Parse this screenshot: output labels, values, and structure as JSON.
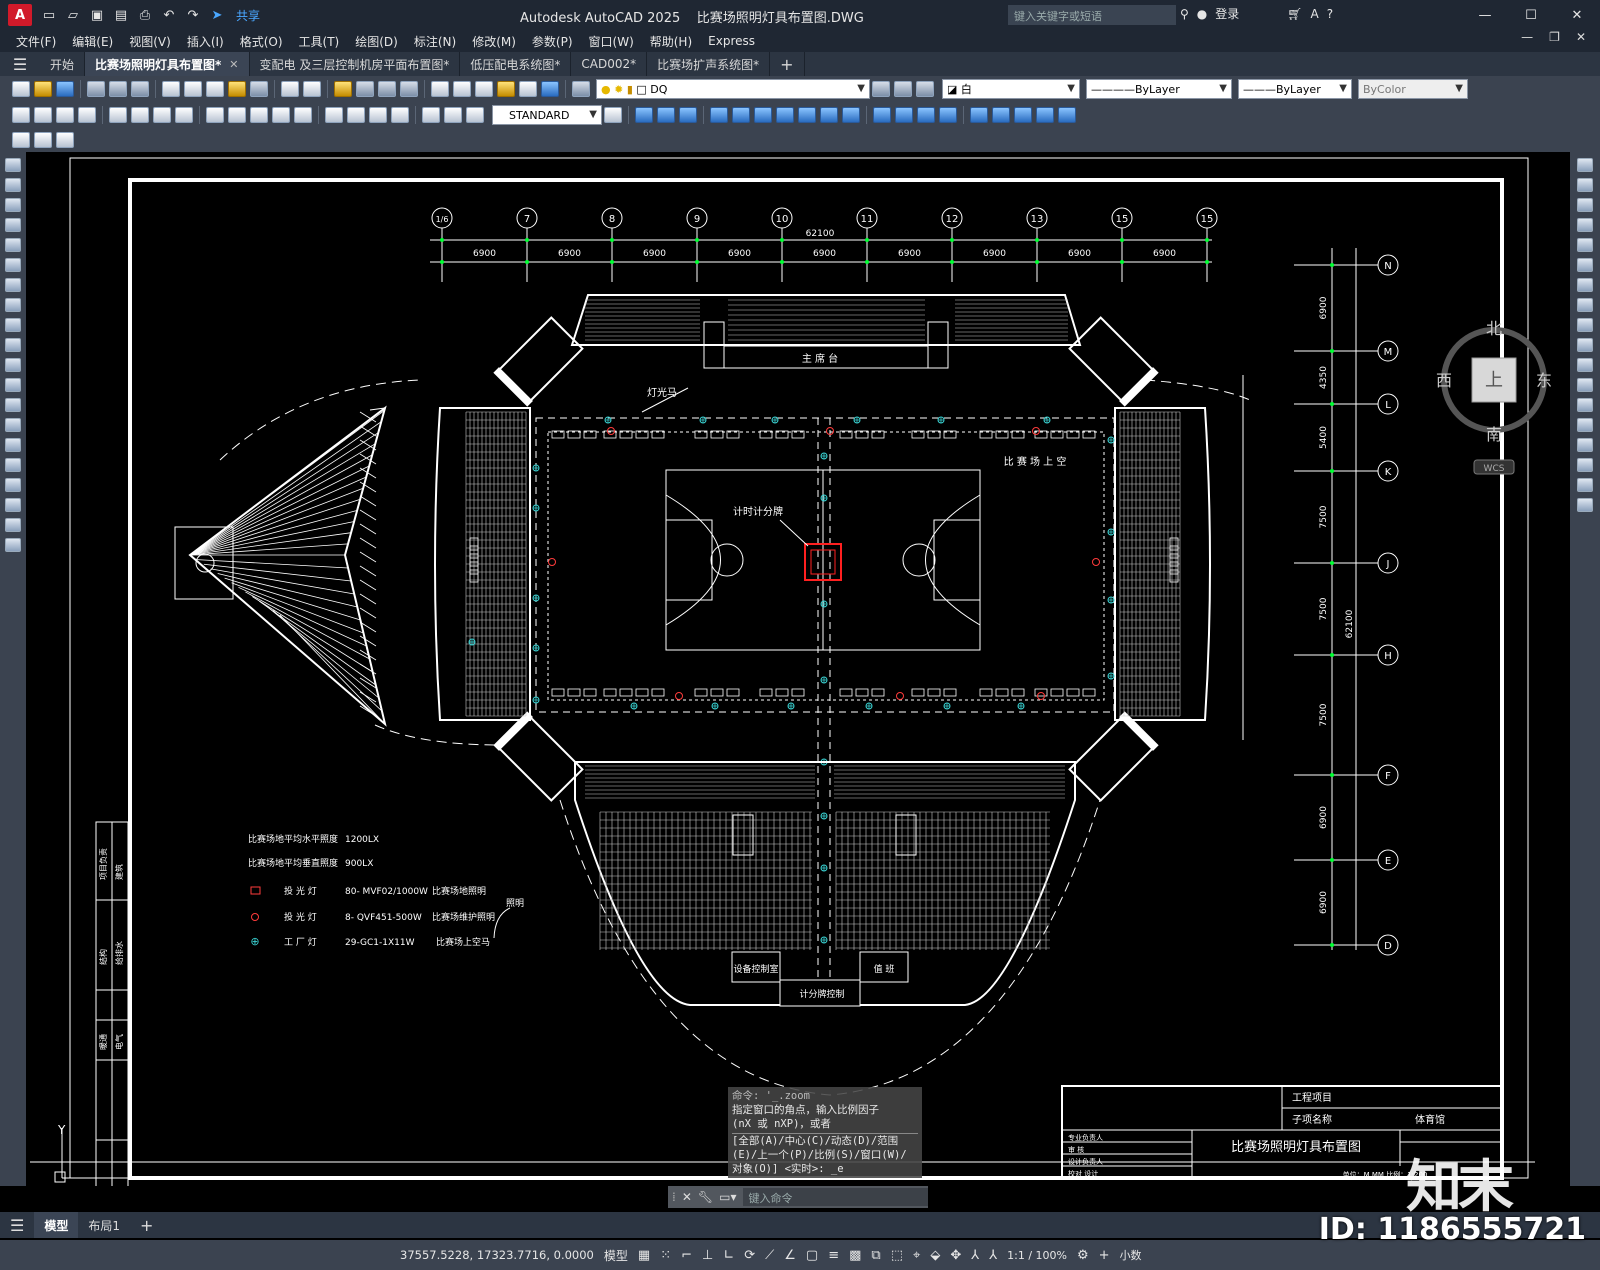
{
  "titlebar": {
    "app_title": "Autodesk AutoCAD 2025",
    "file_title": "比赛场照明灯具布置图.DWG",
    "share_label": "共享",
    "search_placeholder": "键入关键字或短语",
    "login_label": "登录",
    "icons": [
      "new-icon",
      "open-icon",
      "save-icon",
      "saveas-icon",
      "print-icon",
      "undo-icon",
      "redo-icon"
    ]
  },
  "menubar": {
    "items": [
      "文件(F)",
      "编辑(E)",
      "视图(V)",
      "插入(I)",
      "格式(O)",
      "工具(T)",
      "绘图(D)",
      "标注(N)",
      "修改(M)",
      "参数(P)",
      "窗口(W)",
      "帮助(H)",
      "Express"
    ]
  },
  "tabs": [
    {
      "label": "开始",
      "active": false,
      "closable": false
    },
    {
      "label": "比赛场照明灯具布置图*",
      "active": true,
      "closable": true
    },
    {
      "label": "变配电 及三层控制机房平面布置图*",
      "active": false,
      "closable": false
    },
    {
      "label": "低压配电系统图*",
      "active": false,
      "closable": false
    },
    {
      "label": "CAD002*",
      "active": false,
      "closable": false
    },
    {
      "label": "比赛场扩声系统图*",
      "active": false,
      "closable": false
    }
  ],
  "toolbar": {
    "layer_value": "DQ",
    "color_value": "白",
    "linetype_value": "ByLayer",
    "lineweight_value": "ByLayer",
    "plotstyle_value": "ByColor",
    "dimstyle_value": "STANDARD"
  },
  "viewcube": {
    "north": "北",
    "south": "南",
    "east": "东",
    "west": "西",
    "top": "上",
    "wcs": "WCS"
  },
  "drawing": {
    "column_axes": [
      "1/6",
      "7",
      "8",
      "9",
      "10",
      "11",
      "12",
      "13",
      "15",
      "15"
    ],
    "column_spans": [
      "6900",
      "6900",
      "6900",
      "6900",
      "6900",
      "6900",
      "6900",
      "6900",
      "6900"
    ],
    "total_width": "62100",
    "row_axes": [
      "N",
      "M",
      "L",
      "K",
      "J",
      "H",
      "F",
      "E",
      "D"
    ],
    "row_spans": [
      "6900",
      "4350",
      "5400",
      "7500",
      "7500",
      "7500",
      "6900",
      "6900"
    ],
    "total_height": "62100",
    "labels": {
      "rostrum": "主 席 台",
      "light_path": "灯光马",
      "over_field": "比 赛 场 上 空",
      "scoreboard": "计时计分牌",
      "equipment_room": "设备控制室",
      "duty_room": "值 班",
      "score_control": "计分牌控制"
    },
    "legend": {
      "h_lux_label": "比赛场地平均水平照度",
      "h_lux_value": "1200LX",
      "v_lux_label": "比赛场地平均垂直照度",
      "v_lux_value": "900LX",
      "rows": [
        {
          "name": "投 光 灯",
          "spec": "80- MVF02/1000W",
          "use": "比赛场地照明"
        },
        {
          "name": "投 光 灯",
          "spec": "8- QVF451-500W",
          "use": "比赛场维护照明"
        },
        {
          "name": "工 厂 灯",
          "spec": "29-GC1-1X11W",
          "use": "比赛场上空马"
        }
      ],
      "note": "照明"
    },
    "title_block": {
      "project_label": "工程项目",
      "subitem_label": "子项名称",
      "subitem_value": "体育馆",
      "drawing_title": "比赛场照明灯具布置图",
      "unit_scale": "单位：M,MM  比例：1:200",
      "rows": [
        "专业负责人",
        "审 核",
        "设计负责人",
        "校对  设计"
      ]
    },
    "side_table": [
      "项目负责",
      "建筑",
      "结构",
      "给排水",
      "暖通",
      "电气"
    ],
    "ucs_label": "Y"
  },
  "command": {
    "history": [
      "命令: '_.zoom",
      "指定窗口的角点，输入比例因子",
      "(nX 或 nXP)，或者",
      "[全部(A)/中心(C)/动态(D)/范围",
      "(E)/上一个(P)/比例(S)/窗口(W)/",
      "对象(O)] <实时>: _e"
    ],
    "input_placeholder": "键入命令"
  },
  "layouts": [
    {
      "label": "模型",
      "active": true
    },
    {
      "label": "布局1",
      "active": false
    }
  ],
  "statusbar": {
    "coords": "37557.5228, 17323.7716, 0.0000",
    "model_label": "模型",
    "annoscale": "1:1 / 100%",
    "units": "小数"
  },
  "watermark": {
    "id_text": "ID: 1186555721",
    "logo_text": "知末"
  },
  "colors": {
    "background": "#000000",
    "ui_dark": "#1f2733",
    "toolbar": "#3b4350",
    "accent": "#d11a2a",
    "floodlight": "#ff3b3b",
    "factory_light": "#39d0d0",
    "axis_green": "#00ff33"
  }
}
